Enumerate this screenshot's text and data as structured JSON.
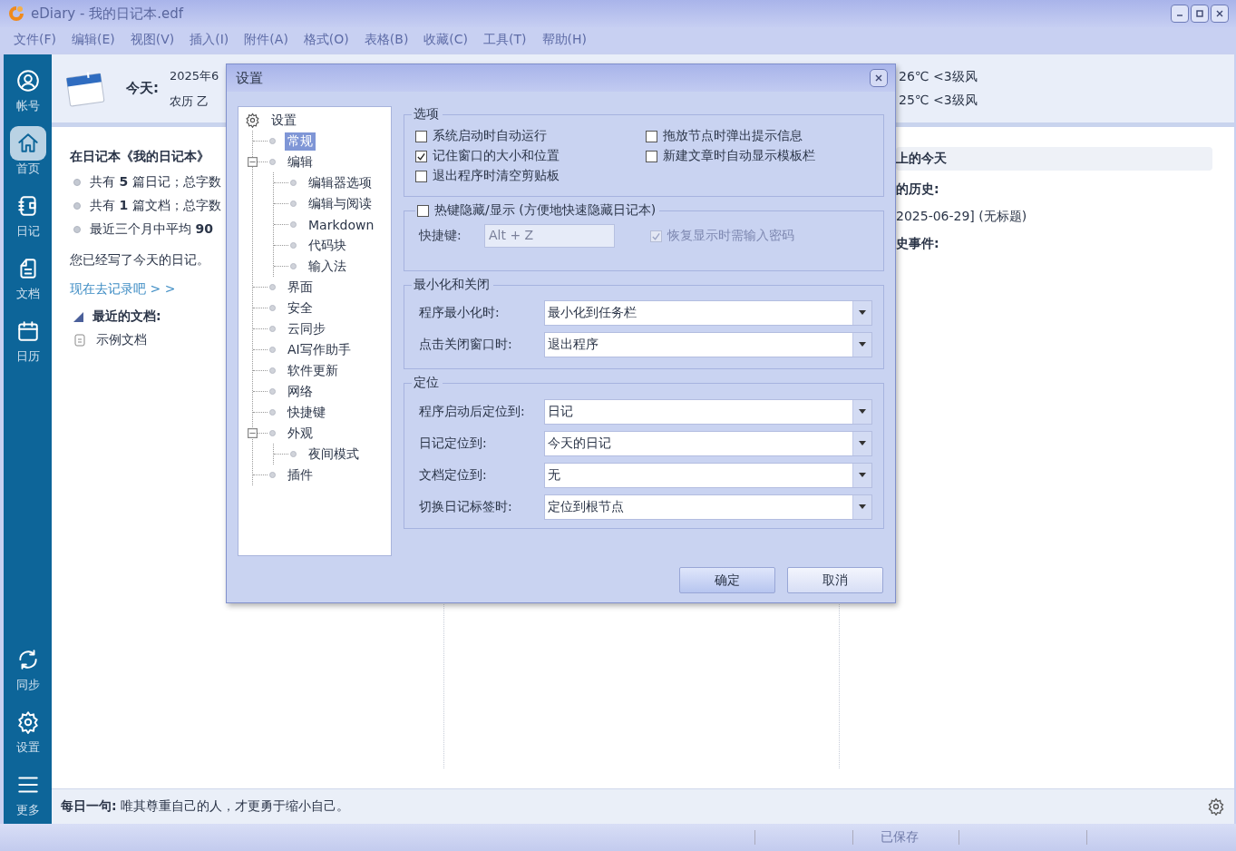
{
  "window": {
    "title": "eDiary - 我的日记本.edf"
  },
  "menu": [
    "文件(F)",
    "编辑(E)",
    "视图(V)",
    "插入(I)",
    "附件(A)",
    "格式(O)",
    "表格(B)",
    "收藏(C)",
    "工具(T)",
    "帮助(H)"
  ],
  "sidebar": {
    "top": [
      {
        "label": "帐号",
        "selected": false
      },
      {
        "label": "首页",
        "selected": true
      },
      {
        "label": "日记",
        "selected": false
      },
      {
        "label": "文档",
        "selected": false
      },
      {
        "label": "日历",
        "selected": false
      }
    ],
    "bottom": [
      {
        "label": "同步"
      },
      {
        "label": "设置"
      },
      {
        "label": "更多"
      }
    ]
  },
  "today": {
    "label": "今天:",
    "date": "2025年6",
    "lunar": "农历 乙",
    "weather": [
      "26℃ <3级风",
      "25℃ <3级风"
    ]
  },
  "overview": {
    "heading": "在日记本《我的日记本》",
    "stats": [
      "共有 **5** 篇日记；总字数",
      "共有 **1** 篇文档；总字数",
      "最近三个月中平均 **90**"
    ],
    "status": "您已经写了今天的日记。",
    "link": "现在去记录吧 > >",
    "recent": {
      "label": "最近的文档:",
      "expanded": true,
      "items": [
        "示例文档"
      ]
    }
  },
  "history": {
    "heading": "上的今天",
    "mine_label": "的历史:",
    "entries": [
      "2025-06-29] (无标题)"
    ],
    "events_label": "史事件:"
  },
  "quote": "**每日一句:** 唯其尊重自己的人，才更勇于缩小自己。",
  "status_bar": {
    "state": "已保存"
  },
  "dialog": {
    "title": "设置",
    "tree": {
      "label": "设置",
      "children": [
        {
          "label": "常规",
          "selected": true
        },
        {
          "label": "编辑",
          "selected": false,
          "expanded": true,
          "children": [
            {
              "label": "编辑器选项",
              "selected": false
            },
            {
              "label": "编辑与阅读",
              "selected": false
            },
            {
              "label": "Markdown",
              "selected": false
            },
            {
              "label": "代码块",
              "selected": false
            },
            {
              "label": "输入法",
              "selected": false
            }
          ]
        },
        {
          "label": "界面",
          "selected": false
        },
        {
          "label": "安全",
          "selected": false
        },
        {
          "label": "云同步",
          "selected": false
        },
        {
          "label": "AI写作助手",
          "selected": false
        },
        {
          "label": "软件更新",
          "selected": false
        },
        {
          "label": "网络",
          "selected": false
        },
        {
          "label": "快捷键",
          "selected": false
        },
        {
          "label": "外观",
          "selected": false,
          "expanded": true,
          "children": [
            {
              "label": "夜间模式",
              "selected": false
            }
          ]
        },
        {
          "label": "插件",
          "selected": false
        }
      ]
    },
    "options": {
      "title": "选项",
      "checkboxes": [
        {
          "label": "系统启动时自动运行",
          "checked": false
        },
        {
          "label": "拖放节点时弹出提示信息",
          "checked": false
        },
        {
          "label": "记住窗口的大小和位置",
          "checked": true
        },
        {
          "label": "新建文章时自动显示模板栏",
          "checked": false
        },
        {
          "label": "退出程序时清空剪贴板",
          "checked": false
        }
      ]
    },
    "hotkey": {
      "label": "热键隐藏/显示 (方便地快速隐藏日记本)",
      "checked": false,
      "shortcut_label": "快捷键:",
      "shortcut_value": "Alt + Z",
      "disabled": true,
      "password": {
        "label": "恢复显示时需输入密码",
        "checked": true
      }
    },
    "minimize": {
      "title": "最小化和关闭",
      "fields": [
        {
          "label": "程序最小化时:",
          "value": "最小化到任务栏"
        },
        {
          "label": "点击关闭窗口时:",
          "value": "退出程序"
        }
      ]
    },
    "locate": {
      "title": "定位",
      "fields": [
        {
          "label": "程序启动后定位到:",
          "value": "日记"
        },
        {
          "label": "日记定位到:",
          "value": "今天的日记"
        },
        {
          "label": "文档定位到:",
          "value": "无"
        },
        {
          "label": "切换日记标签时:",
          "value": "定位到根节点"
        }
      ]
    },
    "buttons": [
      "确定",
      "取消"
    ]
  }
}
